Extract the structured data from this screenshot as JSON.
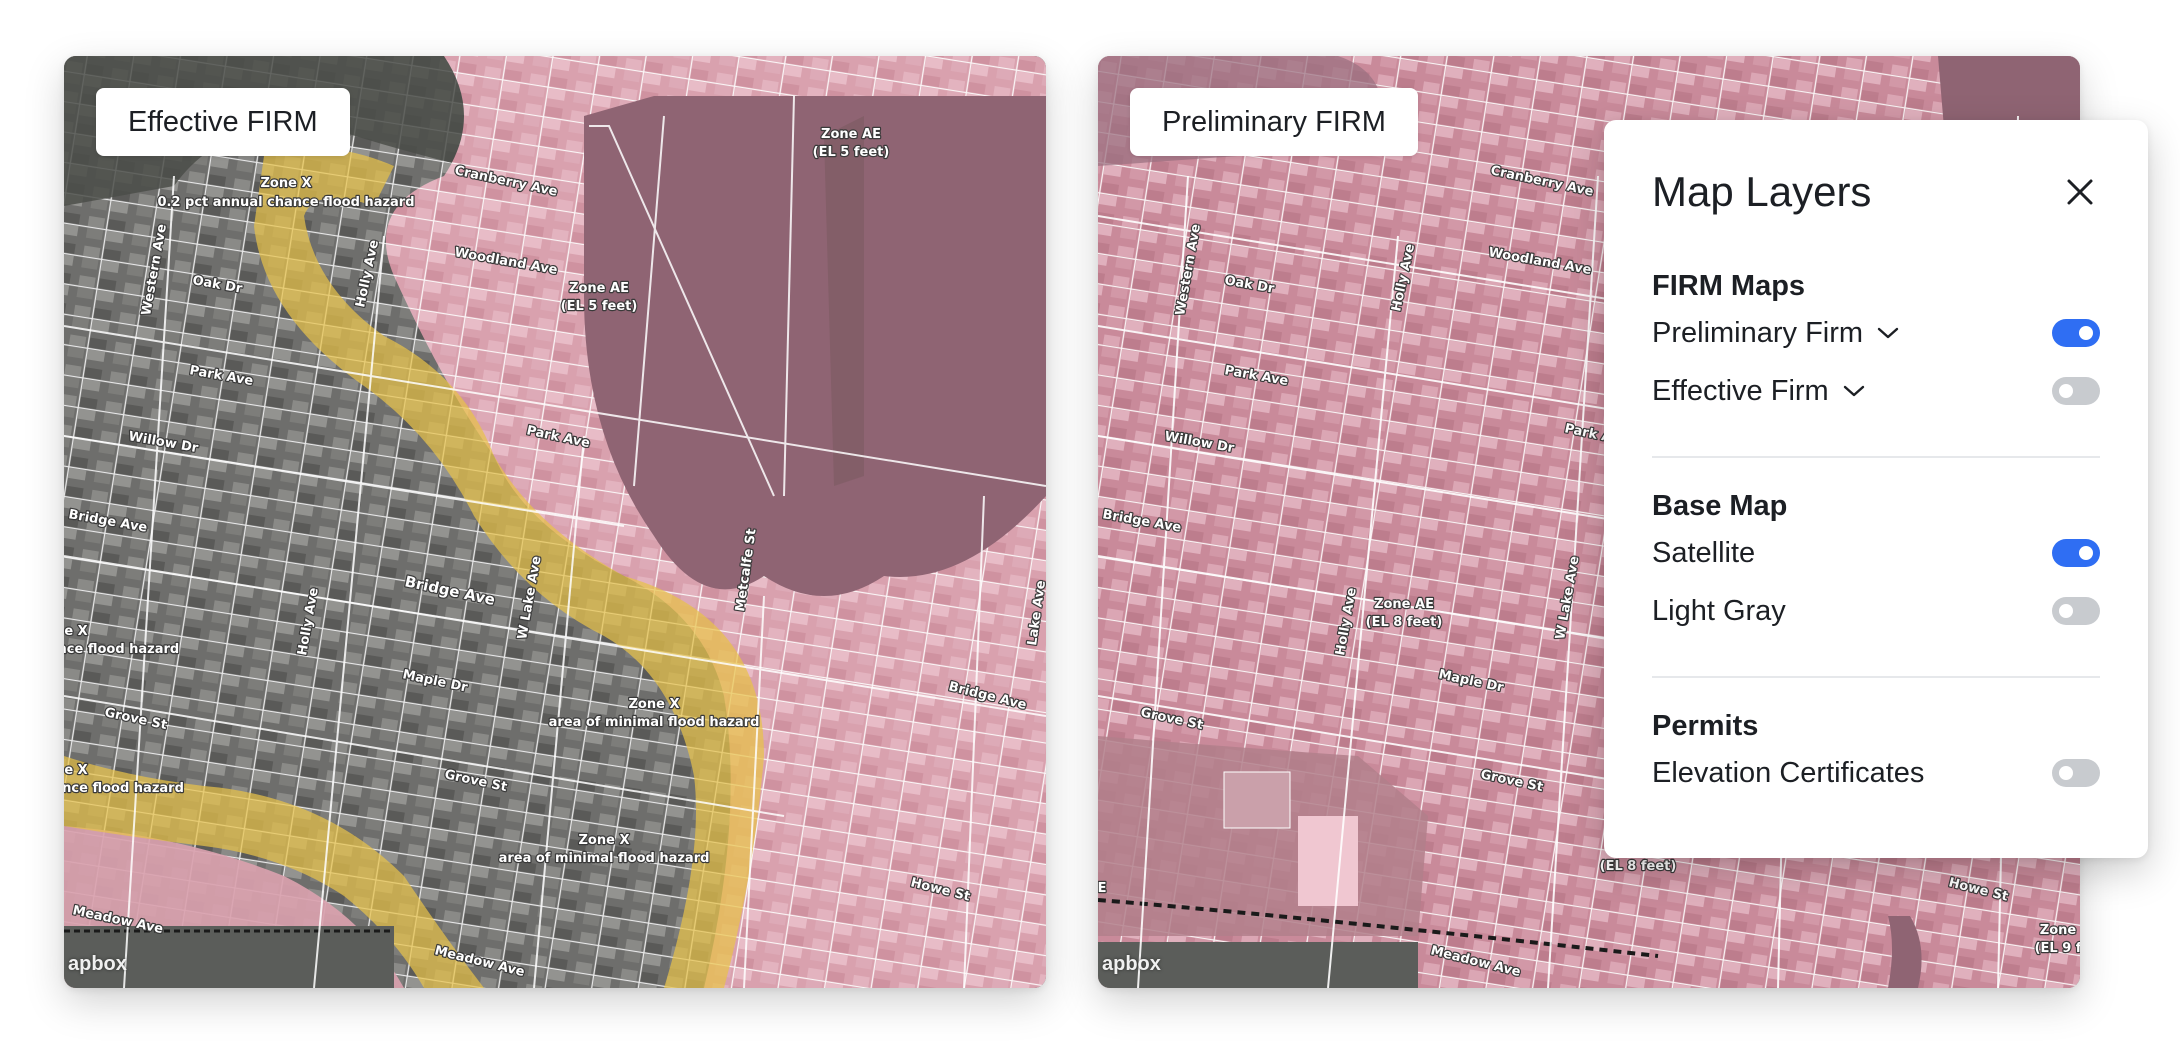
{
  "left_map": {
    "title": "Effective FIRM",
    "attribution": "apbox",
    "labels": {
      "zone_x_a": "Zone X",
      "zone_x_a_sub": "0.2 pct annual chance flood hazard",
      "zone_ae_a": "Zone AE",
      "zone_ae_a_sub": "(EL 5 feet)",
      "zone_ae_b": "Zone AE",
      "zone_ae_b_sub": "(EL 5 feet)",
      "zone_x_b": "Zone X",
      "zone_x_b_sub": "area of minimal flood hazard",
      "zone_x_c": "Zone X",
      "zone_x_c_sub": "area of minimal flood hazard",
      "zone_x_edge1": "e X",
      "zone_x_edge1_sub": "ance flood hazard",
      "zone_x_edge2": "e X",
      "zone_x_edge2_sub": "hance flood hazard",
      "cranberry": "Cranberry Ave",
      "woodland": "Woodland Ave",
      "western": "Western Ave",
      "oak": "Oak Dr",
      "holly1": "Holly Ave",
      "park": "Park Ave",
      "park2": "Park Ave",
      "willow": "Willow Dr",
      "bridge1": "Bridge Ave",
      "bridge2": "Bridge Ave",
      "bridge3": "Bridge Ave",
      "holly2": "Holly Ave",
      "wlake": "W Lake Ave",
      "maple": "Maple Dr",
      "metcalfe": "Metcalfe St",
      "lake": "Lake Ave",
      "grove1": "Grove St",
      "grove2": "Grove St",
      "howe": "Howe St",
      "meadow1": "Meadow Ave",
      "meadow2": "Meadow Ave"
    }
  },
  "right_map": {
    "title": "Preliminary FIRM",
    "attribution": "apbox",
    "labels": {
      "cranberry": "Cranberry Ave",
      "woodland": "Woodland Ave",
      "western": "Western Ave",
      "oak": "Oak Dr",
      "holly1": "Holly Ave",
      "park": "Park Ave",
      "park2": "Park A",
      "willow": "Willow Dr",
      "bridge": "Bridge Ave",
      "zone_ae": "Zone AE",
      "zone_ae_sub": "(EL 8 feet)",
      "holly2": "Holly Ave",
      "wlake": "W Lake Ave",
      "maple": "Maple Dr",
      "grove1": "Grove St",
      "grove2": "Grove St",
      "el8": "(EL 8 feet)",
      "howe": "Howe St",
      "meadow": "Meadow Ave",
      "zone_edge": "Zone",
      "zone_edge_sub": "(EL 9 f",
      "e_edge": "E"
    }
  },
  "layers_panel": {
    "title": "Map Layers",
    "close_icon": "close-icon",
    "sections": {
      "firm_maps": {
        "heading": "FIRM Maps",
        "items": [
          {
            "label": "Preliminary Firm",
            "on": true,
            "expandable": true
          },
          {
            "label": "Effective Firm",
            "on": false,
            "expandable": true
          }
        ]
      },
      "base_map": {
        "heading": "Base Map",
        "items": [
          {
            "label": "Satellite",
            "on": true
          },
          {
            "label": "Light Gray",
            "on": false
          }
        ]
      },
      "permits": {
        "heading": "Permits",
        "items": [
          {
            "label": "Elevation Certificates",
            "on": false
          }
        ]
      }
    }
  },
  "colors": {
    "toggle_on": "#2f6ef3",
    "toggle_off": "#c8cbcf",
    "flood_zone_ae": "#c87a8c",
    "flood_zone_x_shaded": "#e6c04a",
    "water": "#8a6070"
  }
}
